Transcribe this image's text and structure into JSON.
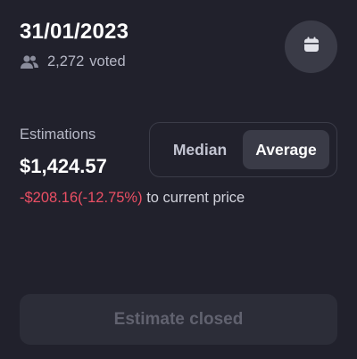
{
  "header": {
    "date": "31/01/2023",
    "votes_count": "2,272",
    "votes_label": "voted",
    "votes_icon": "users-icon",
    "calendar_icon": "calendar-icon"
  },
  "estimations": {
    "label": "Estimations",
    "value": "$1,424.57",
    "change_amount": "-$208.16(-12.75%)",
    "change_suffix": "to current price"
  },
  "toggle": {
    "options": [
      "Median",
      "Average"
    ],
    "selected": "Average"
  },
  "action": {
    "closed_label": "Estimate closed"
  },
  "colors": {
    "background": "#21212c",
    "negative": "#ea4f64",
    "surface": "#3a3b47",
    "muted_text": "#b6b8c6"
  }
}
